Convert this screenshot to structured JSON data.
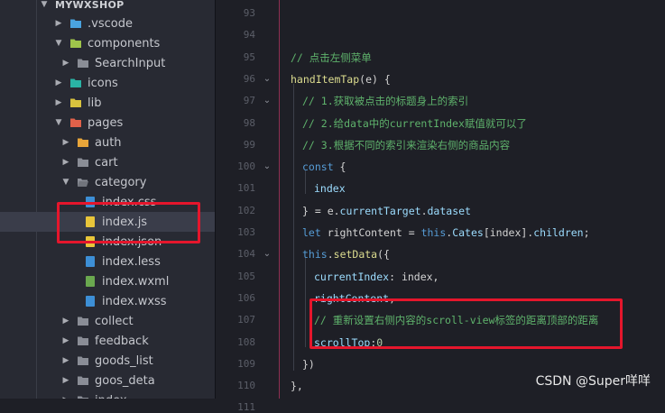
{
  "explorer": {
    "root": "MYWXSHOP",
    "items": [
      {
        "label": ".vscode",
        "type": "folder",
        "icon": "vscode-folder-icon",
        "color": "#4aa3df",
        "arrow": "▶"
      },
      {
        "label": "components",
        "type": "folder",
        "icon": "components-folder-icon",
        "color": "#9fc54b",
        "arrow": "▼"
      },
      {
        "label": "SearchInput",
        "type": "folder",
        "icon": "folder-icon",
        "color": "#8a8d96",
        "arrow": "▶"
      },
      {
        "label": "icons",
        "type": "folder",
        "icon": "icons-folder-icon",
        "color": "#2ab3a5",
        "arrow": "▶"
      },
      {
        "label": "lib",
        "type": "folder",
        "icon": "lib-folder-icon",
        "color": "#d8c23e",
        "arrow": "▶"
      },
      {
        "label": "pages",
        "type": "folder",
        "icon": "pages-folder-icon",
        "color": "#e0614a",
        "arrow": "▼"
      },
      {
        "label": "auth",
        "type": "folder",
        "icon": "auth-folder-icon",
        "color": "#e8a53a",
        "arrow": "▶"
      },
      {
        "label": "cart",
        "type": "folder",
        "icon": "folder-icon",
        "color": "#8a8d96",
        "arrow": "▶"
      },
      {
        "label": "category",
        "type": "folder",
        "icon": "folder-open-icon",
        "color": "#8a8d96",
        "arrow": "▼"
      },
      {
        "label": "index.css",
        "type": "file",
        "icon": "css-file-icon",
        "color": "#3d8fd6",
        "arrow": ""
      },
      {
        "label": "index.js",
        "type": "file",
        "icon": "js-file-icon",
        "color": "#e8c53a",
        "arrow": "",
        "selected": true
      },
      {
        "label": "index.json",
        "type": "file",
        "icon": "json-file-icon",
        "color": "#e8c53a",
        "arrow": ""
      },
      {
        "label": "index.less",
        "type": "file",
        "icon": "less-file-icon",
        "color": "#3d8fd6",
        "arrow": ""
      },
      {
        "label": "index.wxml",
        "type": "file",
        "icon": "wxml-file-icon",
        "color": "#6aa84f",
        "arrow": ""
      },
      {
        "label": "index.wxss",
        "type": "file",
        "icon": "wxss-file-icon",
        "color": "#3d8fd6",
        "arrow": ""
      },
      {
        "label": "collect",
        "type": "folder",
        "icon": "folder-icon",
        "color": "#8a8d96",
        "arrow": "▶"
      },
      {
        "label": "feedback",
        "type": "folder",
        "icon": "folder-icon",
        "color": "#8a8d96",
        "arrow": "▶"
      },
      {
        "label": "goods_list",
        "type": "folder",
        "icon": "folder-icon",
        "color": "#8a8d96",
        "arrow": "▶"
      },
      {
        "label": "goos_deta",
        "type": "folder",
        "icon": "folder-icon",
        "color": "#8a8d96",
        "arrow": "▶"
      },
      {
        "label": "index",
        "type": "folder",
        "icon": "folder-icon",
        "color": "#8a8d96",
        "arrow": "▶"
      }
    ]
  },
  "editor": {
    "line_numbers": [
      "93",
      "94",
      "95",
      "96",
      "97",
      "98",
      "99",
      "100",
      "101",
      "102",
      "103",
      "104",
      "105",
      "106",
      "107",
      "108",
      "109",
      "110",
      "111"
    ],
    "fold_markers": [
      "96",
      "97",
      "100",
      "104"
    ],
    "lines": [
      [],
      [],
      [
        {
          "t": "// 点击左侧菜单",
          "c": "cm"
        }
      ],
      [
        {
          "t": "handItemTap",
          "c": "fn"
        },
        {
          "t": "(e) {",
          "c": ""
        }
      ],
      [
        {
          "t": "// 1.获取被点击的标题身上的索引",
          "c": "cm"
        }
      ],
      [
        {
          "t": "// 2.给data中的currentIndex赋值就可以了",
          "c": "cm"
        }
      ],
      [
        {
          "t": "// 3.根据不同的索引来渲染右侧的商品内容",
          "c": "cm"
        }
      ],
      [
        {
          "t": "const",
          "c": "kb"
        },
        {
          "t": " {",
          "c": ""
        }
      ],
      [
        {
          "t": "index",
          "c": "pr"
        }
      ],
      [
        {
          "t": "} = e.",
          "c": ""
        },
        {
          "t": "currentTarget",
          "c": "pr"
        },
        {
          "t": ".",
          "c": ""
        },
        {
          "t": "dataset",
          "c": "pr"
        }
      ],
      [
        {
          "t": "let",
          "c": "kb"
        },
        {
          "t": " rightContent = ",
          "c": ""
        },
        {
          "t": "this",
          "c": "kb"
        },
        {
          "t": ".",
          "c": ""
        },
        {
          "t": "Cates",
          "c": "pr"
        },
        {
          "t": "[index].",
          "c": ""
        },
        {
          "t": "children",
          "c": "pr"
        },
        {
          "t": ";",
          "c": ""
        }
      ],
      [
        {
          "t": "this",
          "c": "kb"
        },
        {
          "t": ".",
          "c": ""
        },
        {
          "t": "setData",
          "c": "fn"
        },
        {
          "t": "({",
          "c": ""
        }
      ],
      [
        {
          "t": "currentIndex",
          "c": "pr"
        },
        {
          "t": ": index,",
          "c": ""
        }
      ],
      [
        {
          "t": "rightContent",
          "c": "pr"
        },
        {
          "t": ",",
          "c": ""
        }
      ],
      [
        {
          "t": "// 重新设置右侧内容的scroll-view标签的距离顶部的距离",
          "c": "cm"
        }
      ],
      [
        {
          "t": "scrollTop",
          "c": "pr"
        },
        {
          "t": ":",
          "c": ""
        },
        {
          "t": "0",
          "c": "nm"
        }
      ],
      [
        {
          "t": "})",
          "c": ""
        }
      ],
      [
        {
          "t": "},",
          "c": ""
        }
      ],
      []
    ]
  },
  "watermark": "CSDN @Super咩咩",
  "colors": {
    "highlight_box": "#e5162c",
    "background": "#1e1f26",
    "sidebar": "#282a33"
  }
}
